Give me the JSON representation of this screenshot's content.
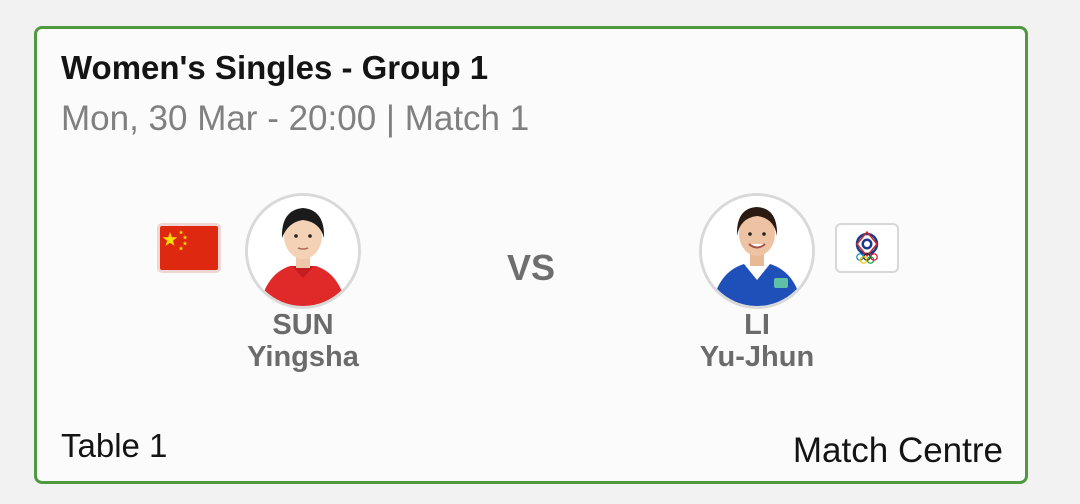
{
  "match": {
    "title": "Women's Singles - Group 1",
    "subtitle": "Mon, 30 Mar - 20:00 | Match 1",
    "vs_label": "VS",
    "table_label": "Table 1",
    "match_centre_label": "Match Centre"
  },
  "players": {
    "home": {
      "last_name": "SUN",
      "first_name": "Yingsha",
      "flag_icon": "china-flag-icon",
      "shirt_color": "#e02a2a"
    },
    "away": {
      "last_name": "LI",
      "first_name": "Yu-Jhun",
      "flag_icon": "chinese-taipei-olympic-flag-icon",
      "shirt_color": "#1f4fb8"
    }
  },
  "colors": {
    "accent_border": "#4f9a3f",
    "china_flag_red": "#de2910",
    "china_flag_yellow": "#ffde00"
  }
}
